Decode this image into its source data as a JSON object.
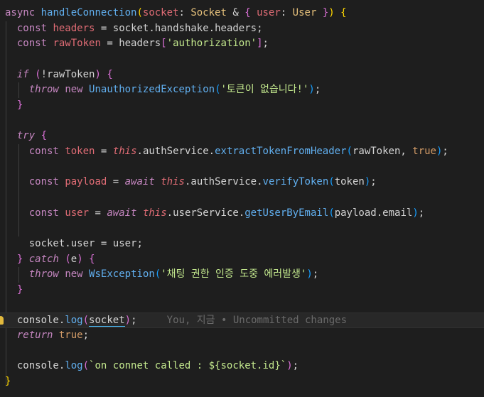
{
  "editor": {
    "blame": "You, 지금 • Uncommitted changes",
    "strings": {
      "authorization": "'authorization'",
      "no_token": "'토큰이 없습니다!'",
      "ws_error": "'채팅 권한 인증 도중 에러발생'",
      "template": "`on connet called : ${socket.id}`"
    },
    "lines": [
      "async handleConnection(socket: Socket & { user: User }) {",
      "  const headers = socket.handshake.headers;",
      "  const rawToken = headers['authorization'];",
      "",
      "  if (!rawToken) {",
      "    throw new UnauthorizedException('토큰이 없습니다!');",
      "  }",
      "",
      "  try {",
      "    const token = this.authService.extractTokenFromHeader(rawToken, true);",
      "",
      "    const payload = await this.authService.verifyToken(token);",
      "",
      "    const user = await this.userService.getUserByEmail(payload.email);",
      "",
      "    socket.user = user;",
      "  } catch (e) {",
      "    throw new WsException('채팅 권한 인증 도중 에러발생');",
      "  }",
      "",
      "  console.log(socket);",
      "  return true;",
      "",
      "  console.log(`on connet called : ${socket.id}`);",
      "}"
    ]
  },
  "colors": {
    "background": "#1e1e1e",
    "keyword": "#c586c0",
    "const": "#4e9cd6",
    "string": "#c3e88d",
    "type": "#e5c07b",
    "variable": "#e06c75",
    "function": "#61afef"
  }
}
